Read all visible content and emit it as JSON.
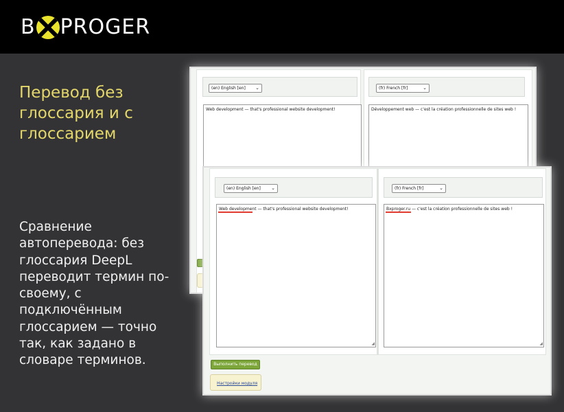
{
  "logo": {
    "prefix": "B",
    "suffix": "PROGER"
  },
  "slide": {
    "heading": "Перевод без глоссария и с глоссарием",
    "body": "Сравнение автоперевода: без глоссария DeepL переводит термин по-своему, с подключённым глоссарием — точно так, как задано в словаре терминов."
  },
  "without_glossary": {
    "source_lang": "(en) English [en]",
    "target_lang": "(fr) French [fr]",
    "source_text": "Web development — that's professional website development!",
    "target_text": "Développement web — c'est la création professionnelle de sites web !"
  },
  "with_glossary": {
    "source_lang": "(en) English [en]",
    "target_lang": "(fr) French [fr]",
    "source_text": "Web development — that's professional website development!",
    "target_text": "Bxproger.ru — c'est la création professionnelle de sites web !",
    "translate_button": "Выполнить перевод",
    "settings_link": "Настройки модуля"
  },
  "colors": {
    "heading": "#e3d66a",
    "accent_logo": "#e9e32e",
    "underline": "#e03a2e",
    "button": "#7da63a"
  }
}
